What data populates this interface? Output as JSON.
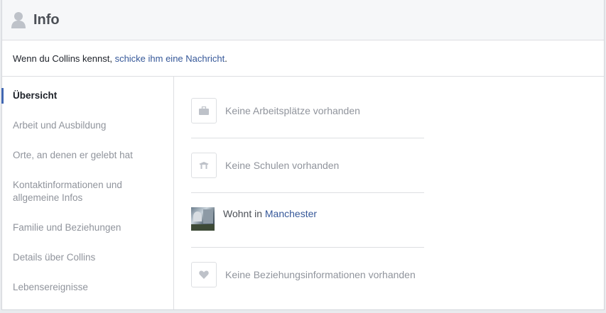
{
  "header": {
    "title": "Info",
    "icon": "person-icon"
  },
  "notice": {
    "prefix": "Wenn du Collins kennst, ",
    "link": "schicke ihm eine Nachricht",
    "suffix": "."
  },
  "sidebar": {
    "items": [
      {
        "label": "Übersicht",
        "active": true
      },
      {
        "label": "Arbeit und Ausbildung"
      },
      {
        "label": "Orte, an denen er gelebt hat"
      },
      {
        "label": "Kontaktinformationen und allgemeine Infos"
      },
      {
        "label": "Familie und Beziehungen"
      },
      {
        "label": "Details über Collins"
      },
      {
        "label": "Lebensereignisse"
      }
    ]
  },
  "overview": {
    "work": {
      "text": "Keine Arbeitsplätze vorhanden",
      "icon": "briefcase-icon"
    },
    "school": {
      "text": "Keine Schulen vorhanden",
      "icon": "school-icon"
    },
    "lives": {
      "prefix": "Wohnt in ",
      "city": "Manchester",
      "icon": "city-photo"
    },
    "relationship": {
      "text": "Keine Beziehungsinformationen vorhanden",
      "icon": "heart-icon"
    }
  },
  "colors": {
    "link": "#365899",
    "accent": "#4267b2",
    "muted": "#90949c"
  }
}
